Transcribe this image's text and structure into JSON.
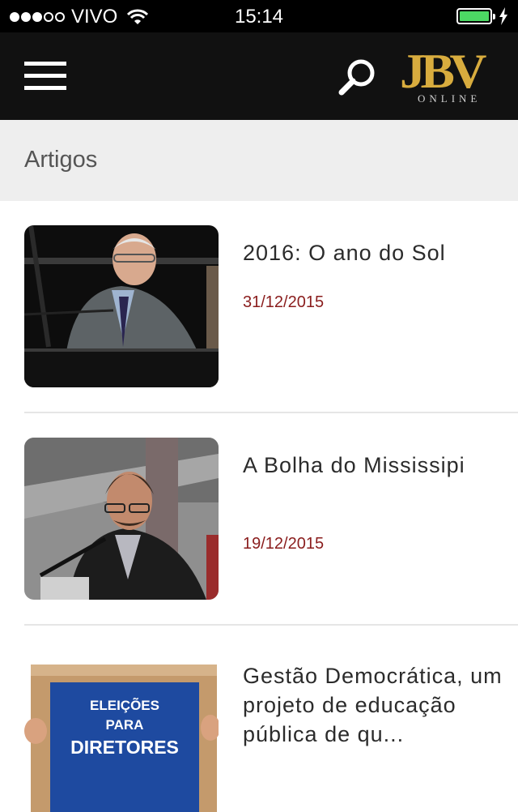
{
  "status_bar": {
    "carrier": "VIVO",
    "time": "15:14",
    "battery_level": 0.95,
    "battery_color": "#4cd964"
  },
  "header": {
    "menu_icon": "hamburger-icon",
    "search_icon": "search-icon",
    "logo_text": "JBV",
    "logo_subtext": "ONLINE",
    "logo_color": "#d8ac3e"
  },
  "section": {
    "title": "Artigos"
  },
  "articles": [
    {
      "title": "2016: O ano do Sol",
      "date": "31/12/2015"
    },
    {
      "title": "A Bolha do Mississipi",
      "date": "19/12/2015"
    },
    {
      "title": "Gestão Democrática, um projeto de educação pública de qu...",
      "date": "",
      "image_text": [
        "ELEIÇÕES",
        "PARA",
        "DIRETORES"
      ]
    }
  ]
}
